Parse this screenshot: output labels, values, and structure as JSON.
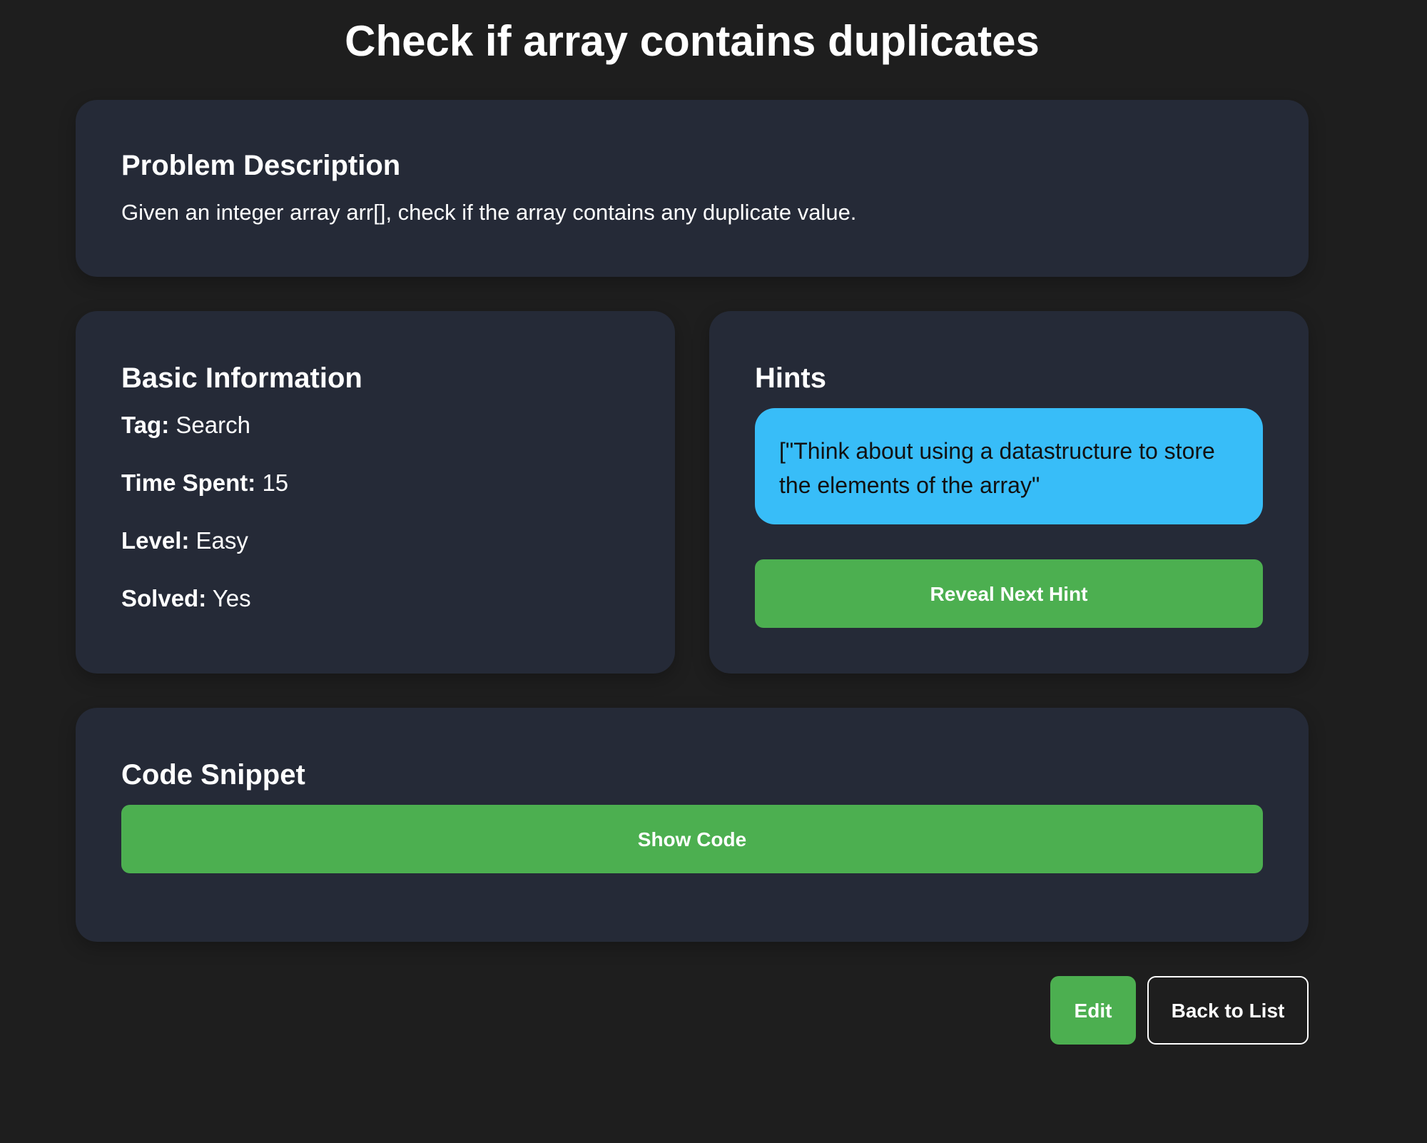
{
  "page": {
    "title": "Check if array contains duplicates"
  },
  "problem": {
    "heading": "Problem Description",
    "description": "Given an integer array arr[], check if the array contains any duplicate value."
  },
  "basic_info": {
    "heading": "Basic Information",
    "tag_label": "Tag:",
    "tag_value": "Search",
    "time_label": "Time Spent:",
    "time_value": "15",
    "level_label": "Level:",
    "level_value": "Easy",
    "solved_label": "Solved:",
    "solved_value": "Yes"
  },
  "hints": {
    "heading": "Hints",
    "current_hint": "[\"Think about using a datastructure to store the elements of the array\"",
    "reveal_label": "Reveal Next Hint"
  },
  "code": {
    "heading": "Code Snippet",
    "show_label": "Show Code"
  },
  "actions": {
    "edit_label": "Edit",
    "back_label": "Back to List"
  },
  "colors": {
    "background": "#1e1e1e",
    "card": "#252a37",
    "accent_green": "#4caf50",
    "hint_blue": "#38bdf8"
  }
}
